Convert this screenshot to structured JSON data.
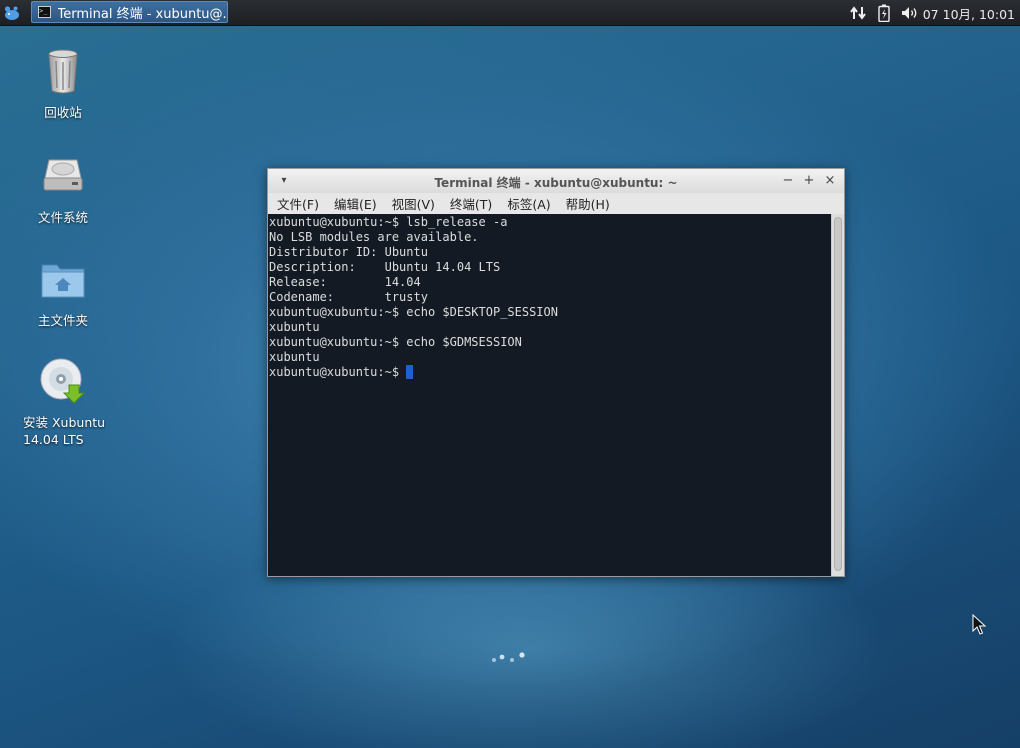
{
  "panel": {
    "menu_icon": "xfce-mouse-icon",
    "task": {
      "icon": "terminal-icon",
      "label": "Terminal 终端 - xubuntu@..."
    },
    "tray": {
      "network_icon": "network-arrows-icon",
      "battery_icon": "battery-icon",
      "volume_icon": "speaker-volume-icon"
    },
    "clock": "07 10月, 10:01"
  },
  "desktop": {
    "icons": [
      {
        "icon": "trash-icon",
        "label": "回收站"
      },
      {
        "icon": "hard-drive-icon",
        "label": "文件系统"
      },
      {
        "icon": "home-folder-icon",
        "label": "主文件夹"
      },
      {
        "icon": "installer-disc-icon",
        "label_line1": "安装 Xubuntu",
        "label_line2": "14.04 LTS"
      }
    ]
  },
  "terminal_window": {
    "title": "Terminal 终端 - xubuntu@xubuntu: ~",
    "buttons": {
      "menu": "▾",
      "minimize": "−",
      "maximize": "+",
      "close": "×"
    },
    "menu": [
      "文件(F)",
      "编辑(E)",
      "视图(V)",
      "终端(T)",
      "标签(A)",
      "帮助(H)"
    ],
    "lines": [
      "xubuntu@xubuntu:~$ lsb_release -a",
      "No LSB modules are available.",
      "Distributor ID: Ubuntu",
      "Description:    Ubuntu 14.04 LTS",
      "Release:        14.04",
      "Codename:       trusty",
      "xubuntu@xubuntu:~$ echo $DESKTOP_SESSION",
      "xubuntu",
      "xubuntu@xubuntu:~$ echo $GDMSESSION",
      "xubuntu"
    ],
    "prompt": "xubuntu@xubuntu:~$ "
  },
  "colors": {
    "terminal_bg": "#141a23",
    "cursor": "#1f5fd0",
    "task_active": "#3a6898"
  }
}
